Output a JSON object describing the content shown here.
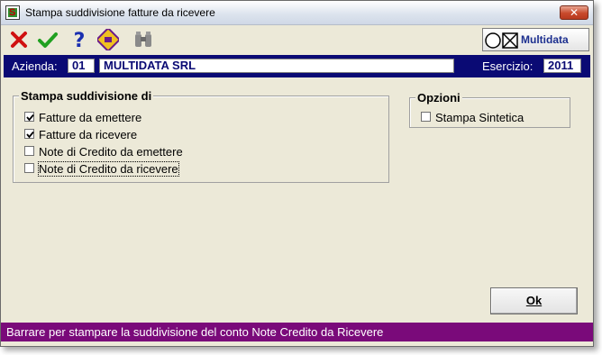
{
  "window": {
    "title": "Stampa suddivisione fatture da ricevere",
    "close_label": "✕"
  },
  "toolbar": {
    "buttons": [
      {
        "icon": "cancel-icon",
        "color": "#d01010"
      },
      {
        "icon": "confirm-icon",
        "color": "#20a020"
      },
      {
        "icon": "help-icon",
        "color": "#1a2fb0"
      },
      {
        "icon": "print-icon",
        "color": "#6a1a8a"
      },
      {
        "icon": "search-binoculars-icon",
        "color": "#8a8a8a"
      }
    ],
    "brand": "Multidata"
  },
  "company_bar": {
    "azienda_label": "Azienda:",
    "azienda_code": "01",
    "azienda_name": "MULTIDATA SRL",
    "esercizio_label": "Esercizio:",
    "esercizio_value": "2011",
    "background": "#0a0a74"
  },
  "stampa_group": {
    "title": "Stampa suddivisione di",
    "options": [
      {
        "label": "Fatture da emettere",
        "checked": true
      },
      {
        "label": "Fatture da ricevere",
        "checked": true
      },
      {
        "label": "Note di Credito da emettere",
        "checked": false
      },
      {
        "label": "Note di Credito da ricevere",
        "checked": false
      }
    ]
  },
  "opzioni_group": {
    "title": "Opzioni",
    "options": [
      {
        "label": "Stampa Sintetica",
        "checked": false
      }
    ]
  },
  "ok_button": {
    "label": "Ok"
  },
  "status": {
    "text": "Barrare per stampare la suddivisione del conto Note Credito da Ricevere",
    "background": "#7a0a7a"
  }
}
